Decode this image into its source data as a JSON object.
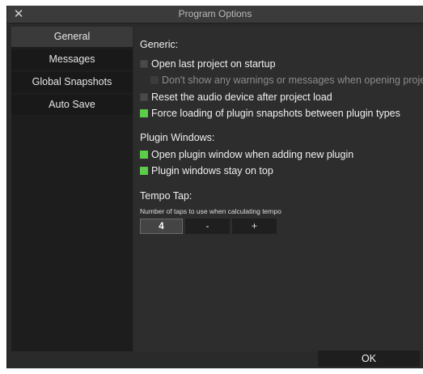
{
  "window": {
    "title": "Program Options",
    "close_glyph": "✕"
  },
  "sidebar": {
    "items": [
      {
        "label": "General",
        "active": true
      },
      {
        "label": "Messages",
        "active": false
      },
      {
        "label": "Global Snapshots",
        "active": false
      },
      {
        "label": "Auto Save",
        "active": false
      }
    ]
  },
  "generic": {
    "title": "Generic:",
    "options": [
      {
        "label": "Open last project on startup",
        "checked": false,
        "enabled": true
      },
      {
        "label": "Don't show any warnings or messages when opening project",
        "checked": false,
        "enabled": false
      },
      {
        "label": "Reset the audio device after project load",
        "checked": false,
        "enabled": true
      },
      {
        "label": "Force loading of plugin snapshots between plugin types",
        "checked": true,
        "enabled": true
      }
    ]
  },
  "plugin_windows": {
    "title": "Plugin Windows:",
    "options": [
      {
        "label": "Open plugin window when adding new plugin",
        "checked": true,
        "enabled": true
      },
      {
        "label": "Plugin windows stay on top",
        "checked": true,
        "enabled": true
      }
    ]
  },
  "tempo_tap": {
    "title": "Tempo Tap:",
    "taps_label": "Number of taps to use when calculating tempo",
    "taps_value": "4",
    "minus_label": "-",
    "plus_label": "+"
  },
  "footer": {
    "ok_label": "OK"
  },
  "colors": {
    "checked": "#5ccc4a",
    "window_bg": "#2a2a2a",
    "sidebar_bg": "#1d1d1d"
  }
}
